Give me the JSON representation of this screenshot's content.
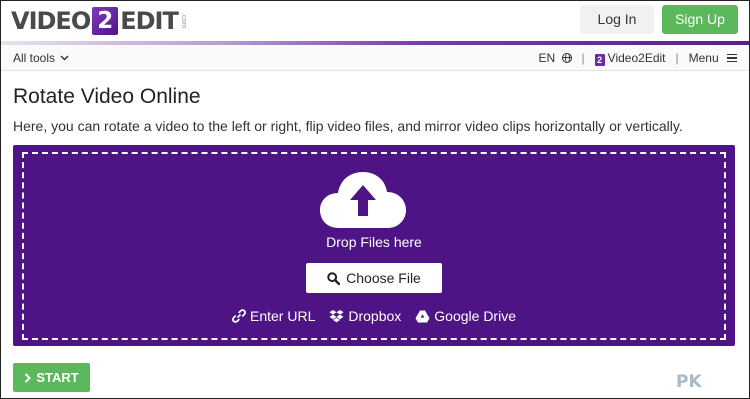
{
  "header": {
    "logo": {
      "left": "VIDEO",
      "mid": "2",
      "right": "EDIT",
      "suffix": ".com"
    },
    "login_label": "Log In",
    "signup_label": "Sign Up"
  },
  "subnav": {
    "all_tools_label": "All tools",
    "language_label": "EN",
    "brand_label": "Video2Edit",
    "menu_label": "Menu"
  },
  "page": {
    "title": "Rotate Video Online",
    "description": "Here, you can rotate a video to the left or right, flip video files, and mirror video clips horizontally or vertically."
  },
  "upload": {
    "drop_text": "Drop Files here",
    "choose_label": "Choose File",
    "sources": [
      {
        "label": "Enter URL",
        "icon": "link-icon"
      },
      {
        "label": "Dropbox",
        "icon": "dropbox-icon"
      },
      {
        "label": "Google Drive",
        "icon": "google-drive-icon"
      }
    ]
  },
  "start_label": "START",
  "watermark": "PK",
  "colors": {
    "brand_purple": "#4e1485",
    "green": "#5cb85c"
  }
}
